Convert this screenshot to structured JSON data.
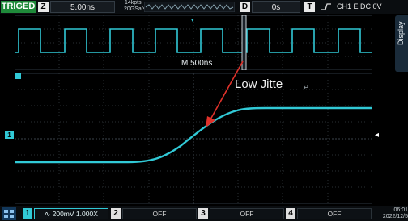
{
  "header": {
    "trig_status": "TRIGED",
    "timebase_key": "Z",
    "timebase_value": "5.00ns",
    "mem_depth": "14kpts",
    "sample_rate": "20GSa/s",
    "delay_key": "D",
    "delay_value": "0s",
    "trigger_key": "T",
    "trigger_source": "CH1 E DC 0V"
  },
  "side_panel": {
    "display_label": "Display"
  },
  "zoom_window": {
    "time_label": "M  500ns"
  },
  "annotation": {
    "text": "Low Jitte",
    "return_mark": "↵"
  },
  "markers": {
    "ch1_marker": "1",
    "trigger_marker": "◂",
    "top_marker": "▾"
  },
  "channels": [
    {
      "number": "1",
      "status": "200mV 1.000X",
      "active": true
    },
    {
      "number": "2",
      "status": "OFF",
      "active": false
    },
    {
      "number": "3",
      "status": "OFF",
      "active": false
    },
    {
      "number": "4",
      "status": "OFF",
      "active": false
    }
  ],
  "clock": {
    "time": "06:01",
    "date": "2022/12/5"
  },
  "colors": {
    "trace": "#31c9d6",
    "trig_badge": "#1f8a3a",
    "arrow": "#e0322b"
  }
}
